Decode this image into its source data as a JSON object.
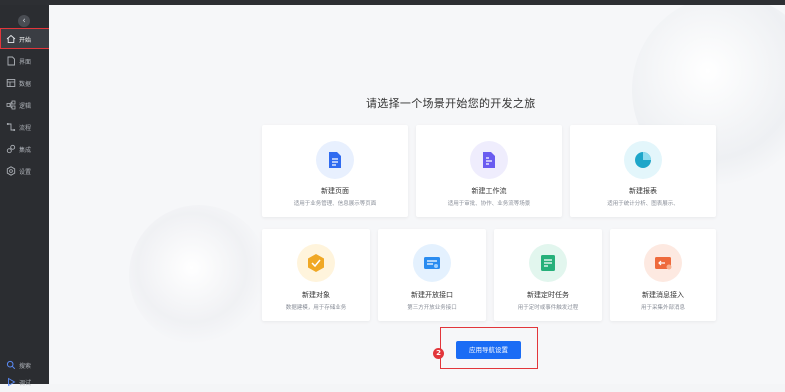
{
  "sidebar": {
    "collapse_glyph": "‹",
    "items": [
      {
        "label": "开始",
        "icon": "home-icon"
      },
      {
        "label": "界面",
        "icon": "page-icon"
      },
      {
        "label": "数据",
        "icon": "table-icon"
      },
      {
        "label": "逻辑",
        "icon": "flow-icon"
      },
      {
        "label": "流程",
        "icon": "process-icon"
      },
      {
        "label": "集成",
        "icon": "link-icon"
      },
      {
        "label": "设置",
        "icon": "gear-icon"
      }
    ],
    "bottom": [
      {
        "label": "搜索",
        "icon": "search-icon"
      },
      {
        "label": "调试",
        "icon": "debug-icon"
      }
    ]
  },
  "annotations": {
    "badge1": "1",
    "badge2": "2"
  },
  "main": {
    "heading": "请选择一个场景开始您的开发之旅",
    "cards": [
      {
        "title": "新建页面",
        "desc": "适用于业务管理、信息展示等页面",
        "icon": "document-icon",
        "color": "#2f6bf0"
      },
      {
        "title": "新建工作流",
        "desc": "适用于审批、协作、业务流等场景",
        "icon": "workflow-icon",
        "color": "#6a5cf0"
      },
      {
        "title": "新建报表",
        "desc": "适用于统计分析、图表展示、",
        "icon": "chart-icon",
        "color": "#1ea6c9"
      },
      {
        "title": "新建对象",
        "desc": "数据建模，用于存储业务",
        "icon": "object-icon",
        "color": "#f0a825"
      },
      {
        "title": "新建开放接口",
        "desc": "第三方开放业务接口",
        "icon": "api-icon",
        "color": "#2a8cf0"
      },
      {
        "title": "新建定时任务",
        "desc": "用于定时或事件触发过程",
        "icon": "schedule-icon",
        "color": "#26b07a"
      },
      {
        "title": "新建消息接入",
        "desc": "用于采集外部消息",
        "icon": "message-icon",
        "color": "#ee6a3c"
      }
    ],
    "nav_settings_button": "应用导航设置"
  },
  "colors": {
    "accent": "#1a6cf5",
    "highlight": "#e2363b",
    "sidebar_bg": "#2b2d31"
  }
}
